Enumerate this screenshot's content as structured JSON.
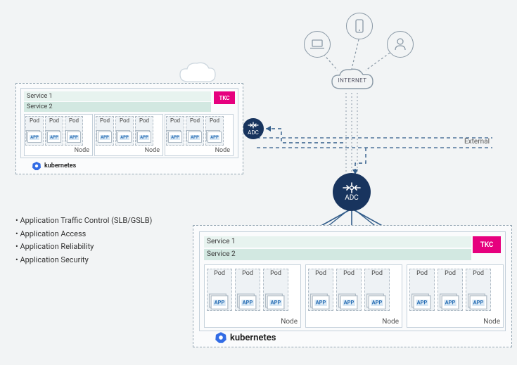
{
  "labels": {
    "internet": "INTERNET",
    "external": "External",
    "adc": "ADC",
    "tkc": "TKC",
    "kubernetes": "kubernetes",
    "service1": "Service 1",
    "service2": "Service 2",
    "node": "Node",
    "pod": "Pod",
    "app": "APP"
  },
  "bullets": [
    "Application Traffic Control (SLB/GSLB)",
    "Application Access",
    "Application Reliability",
    "Application Security"
  ],
  "colors": {
    "adc": "#18345e",
    "tkc": "#e6007e",
    "dash": "#315c8a",
    "solid": "#315c8a"
  }
}
